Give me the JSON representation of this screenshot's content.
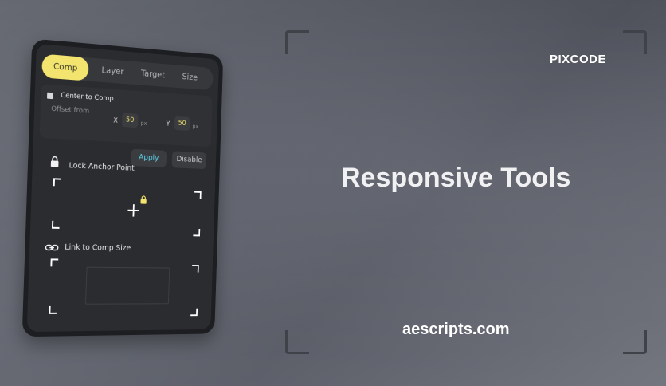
{
  "brand": "PIXCODE",
  "headline": "Responsive Tools",
  "website": "aescripts.com",
  "panel": {
    "tabs": [
      {
        "label": "Comp",
        "active": true
      },
      {
        "label": "Layer",
        "active": false
      },
      {
        "label": "Target",
        "active": false
      },
      {
        "label": "Size",
        "active": false
      }
    ],
    "offset": {
      "checkbox_label": "Center to Comp",
      "offset_label": "Offset from",
      "x_label": "X",
      "x_value": "50",
      "x_unit": "px",
      "y_label": "Y",
      "y_value": "50",
      "y_unit": "px"
    },
    "buttons": {
      "apply": "Apply",
      "disable": "Disable"
    },
    "lock_anchor_label": "Lock Anchor Point",
    "link_comp_label": "Link to Comp Size"
  },
  "colors": {
    "accent": "#f2e46f",
    "apply_text": "#5ad0e8"
  },
  "icons": [
    "lock-icon",
    "plus-icon",
    "link-icon"
  ]
}
